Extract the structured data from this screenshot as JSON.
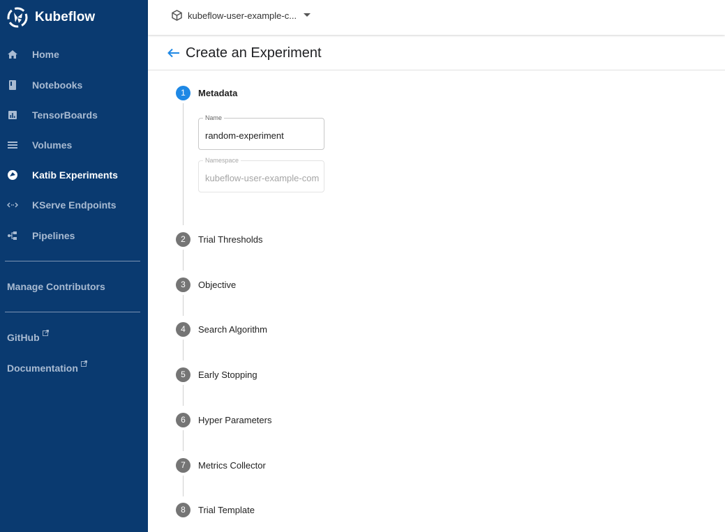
{
  "app": {
    "name": "Kubeflow"
  },
  "sidebar": {
    "items": [
      {
        "label": "Home",
        "icon": "home-icon"
      },
      {
        "label": "Notebooks",
        "icon": "notebook-icon"
      },
      {
        "label": "TensorBoards",
        "icon": "bar-chart-icon"
      },
      {
        "label": "Volumes",
        "icon": "storage-icon"
      },
      {
        "label": "Katib Experiments",
        "icon": "katib-icon",
        "active": true
      },
      {
        "label": "KServe Endpoints",
        "icon": "code-arrows-icon"
      },
      {
        "label": "Pipelines",
        "icon": "pipeline-icon"
      }
    ],
    "manage_contributors": "Manage Contributors",
    "github": "GitHub",
    "documentation": "Documentation"
  },
  "topbar": {
    "namespace": "kubeflow-user-example-c..."
  },
  "page": {
    "title": "Create an Experiment"
  },
  "form": {
    "name_label": "Name",
    "name_value": "random-experiment",
    "namespace_label": "Namespace",
    "namespace_value": "kubeflow-user-example-com"
  },
  "steps": [
    {
      "number": "1",
      "label": "Metadata"
    },
    {
      "number": "2",
      "label": "Trial Thresholds"
    },
    {
      "number": "3",
      "label": "Objective"
    },
    {
      "number": "4",
      "label": "Search Algorithm"
    },
    {
      "number": "5",
      "label": "Early Stopping"
    },
    {
      "number": "6",
      "label": "Hyper Parameters"
    },
    {
      "number": "7",
      "label": "Metrics Collector"
    },
    {
      "number": "8",
      "label": "Trial Template"
    }
  ],
  "colors": {
    "sidebar_bg": "#0a3a70",
    "accent": "#1e88e5",
    "step_inactive": "#757575"
  }
}
